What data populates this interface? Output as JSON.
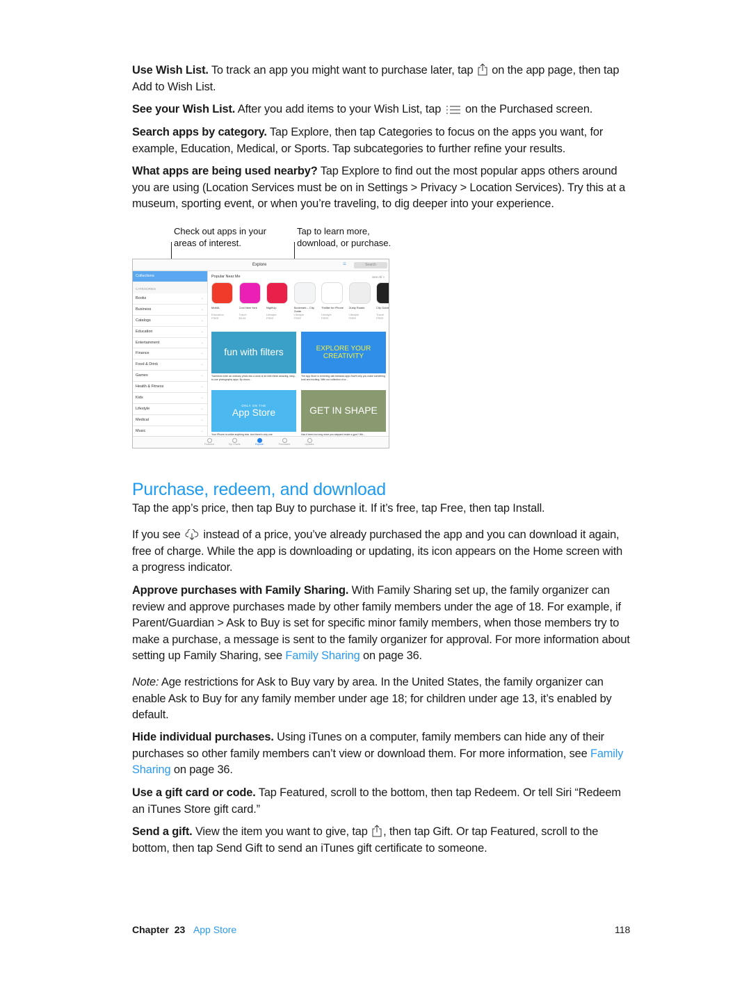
{
  "paragraphs": {
    "wish_list": {
      "lead": "Use Wish List.",
      "before": " To track an app you might want to purchase later, tap ",
      "after": " on the app page, then tap Add to Wish List."
    },
    "see_wish": {
      "lead": "See your Wish List.",
      "before": " After you add items to your Wish List, tap ",
      "after": " on the Purchased screen."
    },
    "search": {
      "lead": "Search apps by category.",
      "text": " Tap Explore, then tap Categories to focus on the apps you want, for example, Education, Medical, or Sports. Tap subcategories to further refine your results."
    },
    "nearby": {
      "lead": "What apps are being used nearby?",
      "text": " Tap Explore to find out the most popular apps others around you are using (Location Services must be on in Settings > Privacy > Location Services). Try this at a museum, sporting event, or when you’re traveling, to dig deeper into your experience."
    }
  },
  "callouts": {
    "left": "Check out apps in your areas of interest.",
    "right": "Tap to learn more, download, or purchase."
  },
  "figure": {
    "title": "Explore",
    "search": "Search",
    "collections": "Collections",
    "categories_header": "CATEGORIES",
    "categories": [
      "Books",
      "Business",
      "Catalogs",
      "Education",
      "Entertainment",
      "Finance",
      "Food & Drink",
      "Games",
      "Health & Fitness",
      "Kids",
      "Lifestyle",
      "Medical",
      "Music"
    ],
    "section": "Popular Near Me",
    "see_all": "See All >",
    "apps": [
      {
        "name": "MoMA",
        "cat": "Education",
        "price": "FREE",
        "color": "#f03a2a"
      },
      {
        "name": "Cool New York",
        "cat": "Travel",
        "price": "$3.99",
        "color": "#ec1fb4"
      },
      {
        "name": "NightUp",
        "cat": "Lifestyle",
        "price": "FREE",
        "color": "#e8204a"
      },
      {
        "name": "Bookmark – City Guide",
        "cat": "Lifestyle",
        "price": "FREE",
        "color": "#f2f4f6"
      },
      {
        "name": "Thrillist for iPhone",
        "cat": "Lifestyle",
        "price": "FREE",
        "color": "#fff"
      },
      {
        "name": "Dusty Roads",
        "cat": "Lifestyle",
        "price": "FREE",
        "color": "#eee"
      },
      {
        "name": "City Guide National",
        "cat": "Travel",
        "price": "FREE",
        "color": "#222"
      }
    ],
    "banners": [
      {
        "title": "fun with filters",
        "caption": "Transform even an ordinary photo into a work of art with these amazing, easy-to-use photography apps. By choos...",
        "color": "#3aa0c8"
      },
      {
        "title": "EXPLORE YOUR CREATIVITY",
        "caption": "The App Store is brimming with fantastic apps that’ll help you make something bold and exciting. With our collection of cr...",
        "color": "#2f8fe8"
      },
      {
        "title": "App Store",
        "subtitle": "ONLY ON THE",
        "caption": "Your iPhone is unlike anything else. And there’s only one",
        "color": "#4bb8f0"
      },
      {
        "title": "GET IN SHAPE",
        "caption": "Has it been too long since you stepped inside a gym? Wh...",
        "color": "#8a9a70"
      }
    ],
    "tabs": [
      "Featured",
      "Top Charts",
      "Explore",
      "Purchased",
      "Updates"
    ],
    "active_tab": "Explore"
  },
  "heading": "Purchase, redeem, and download",
  "purchase": {
    "intro": "Tap the app’s price, then tap Buy to purchase it. If it’s free, tap Free, then tap Install.",
    "redownload": {
      "before": "If you see ",
      "after": " instead of a price, you’ve already purchased the app and you can download it again, free of charge. While the app is downloading or updating, its icon appears on the Home screen with a progress indicator."
    },
    "family": {
      "lead": "Approve purchases with Family Sharing.",
      "text": " With Family Sharing set up, the family organizer can review and approve purchases made by other family members under the age of 18. For example, if Parent/Guardian > Ask to Buy is set for specific minor family members, when those members try to make a purchase, a message is sent to the family organizer for approval. For more information about setting up Family Sharing, see ",
      "link": "Family Sharing",
      "after": " on page 36."
    },
    "note": {
      "lead": "Note:",
      "text": "  Age restrictions for Ask to Buy vary by area. In the United States, the family organizer can enable Ask to Buy for any family member under age 18; for children under age 13, it’s enabled by default."
    },
    "hide": {
      "lead": "Hide individual purchases.",
      "text": " Using iTunes on a computer, family members can hide any of their purchases so other family members can’t view or download them. For more information, see ",
      "link": "Family Sharing",
      "after": " on page 36."
    },
    "gift_card": {
      "lead": "Use a gift card or code.",
      "text": " Tap Featured, scroll to the bottom, then tap Redeem. Or tell Siri “Redeem an iTunes Store gift card.”"
    },
    "send_gift": {
      "lead": "Send a gift.",
      "before": " View the item you want to give, tap ",
      "after": ", then tap Gift. Or tap Featured, scroll to the bottom, then tap Send Gift to send an iTunes gift certificate to someone."
    }
  },
  "footer": {
    "chapter": "Chapter",
    "number": "23",
    "title": "App Store",
    "page": "118"
  },
  "colors": {
    "accent": "#1e9bf0"
  }
}
